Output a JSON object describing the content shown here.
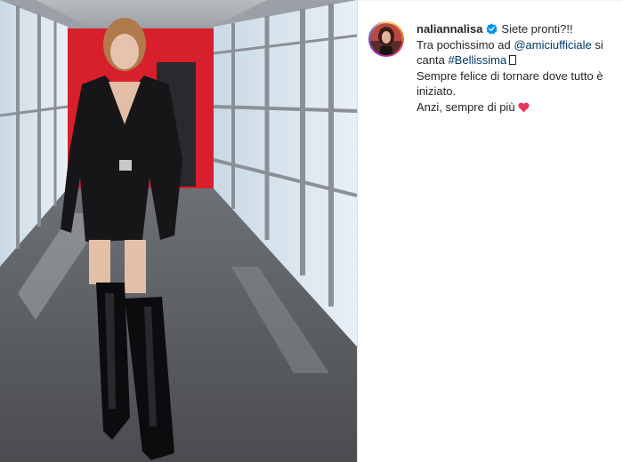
{
  "post": {
    "username": "naliannalisa",
    "verified_icon": "verified-badge-icon",
    "caption": {
      "line1": "Siete pronti?!!",
      "line2_text": "Tra pochissimo ad",
      "line2_mention": "@amiciufficiale",
      "line2_end": "si",
      "line3_text": "canta",
      "line3_hashtag": "#Bellissima",
      "line4": "Sempre felice di tornare dove tutto è",
      "line5": "iniziato.",
      "line6": "Anzi, sempre di più"
    },
    "heart_icon": "heart-emoji",
    "missing_glyph_icon": "missing-glyph-box"
  },
  "colors": {
    "link": "#00376b",
    "text": "#262626",
    "verified": "#0095f6",
    "heart": "#e8345a"
  }
}
